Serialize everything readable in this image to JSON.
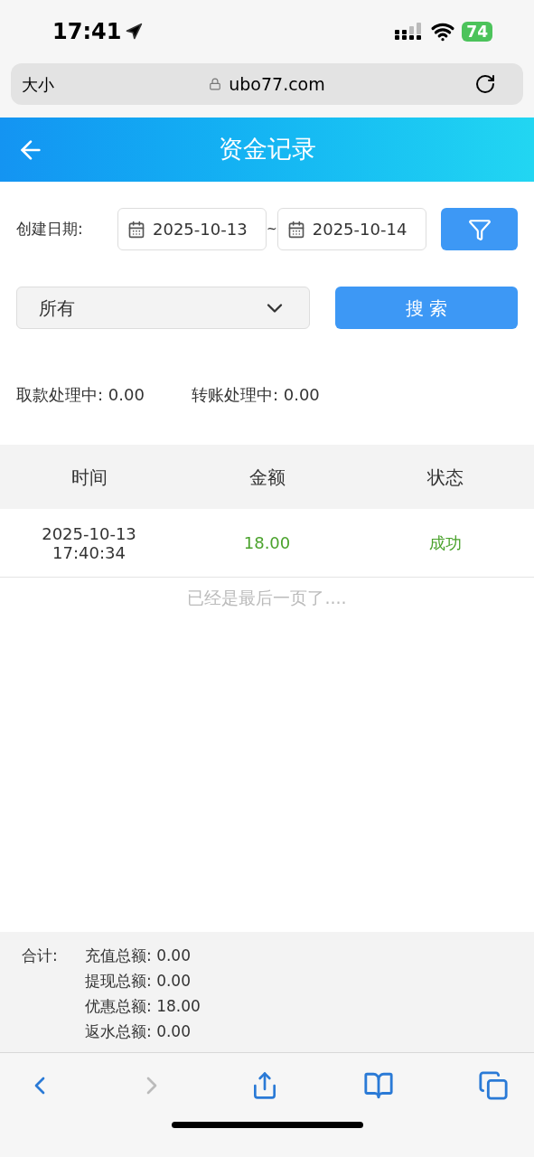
{
  "status_bar": {
    "time": "17:41",
    "battery": "74"
  },
  "browser": {
    "text_size": "大小",
    "url": "ubo77.com"
  },
  "header": {
    "title": "资金记录"
  },
  "filters": {
    "date_label": "创建日期:",
    "date_from": "2025-10-13",
    "separator": "~",
    "date_to": "2025-10-14",
    "type_select": "所有",
    "search_button": "搜 索"
  },
  "pending": [
    {
      "label": "取款处理中:",
      "value": "0.00"
    },
    {
      "label": "转账处理中:",
      "value": "0.00"
    }
  ],
  "table": {
    "columns": [
      "时间",
      "金额",
      "状态"
    ],
    "rows": [
      {
        "date": "2025-10-13",
        "time": "17:40:34",
        "amount": "18.00",
        "status": "成功"
      }
    ],
    "end_note": "已经是最后一页了...."
  },
  "totals": {
    "label": "合计:",
    "items": [
      {
        "label": "充值总额:",
        "value": "0.00"
      },
      {
        "label": "提现总额:",
        "value": "0.00"
      },
      {
        "label": "优惠总额:",
        "value": "18.00"
      },
      {
        "label": "返水总额:",
        "value": "0.00"
      }
    ]
  },
  "toolbar": {
    "back_disabled": false,
    "forward_disabled": true
  }
}
